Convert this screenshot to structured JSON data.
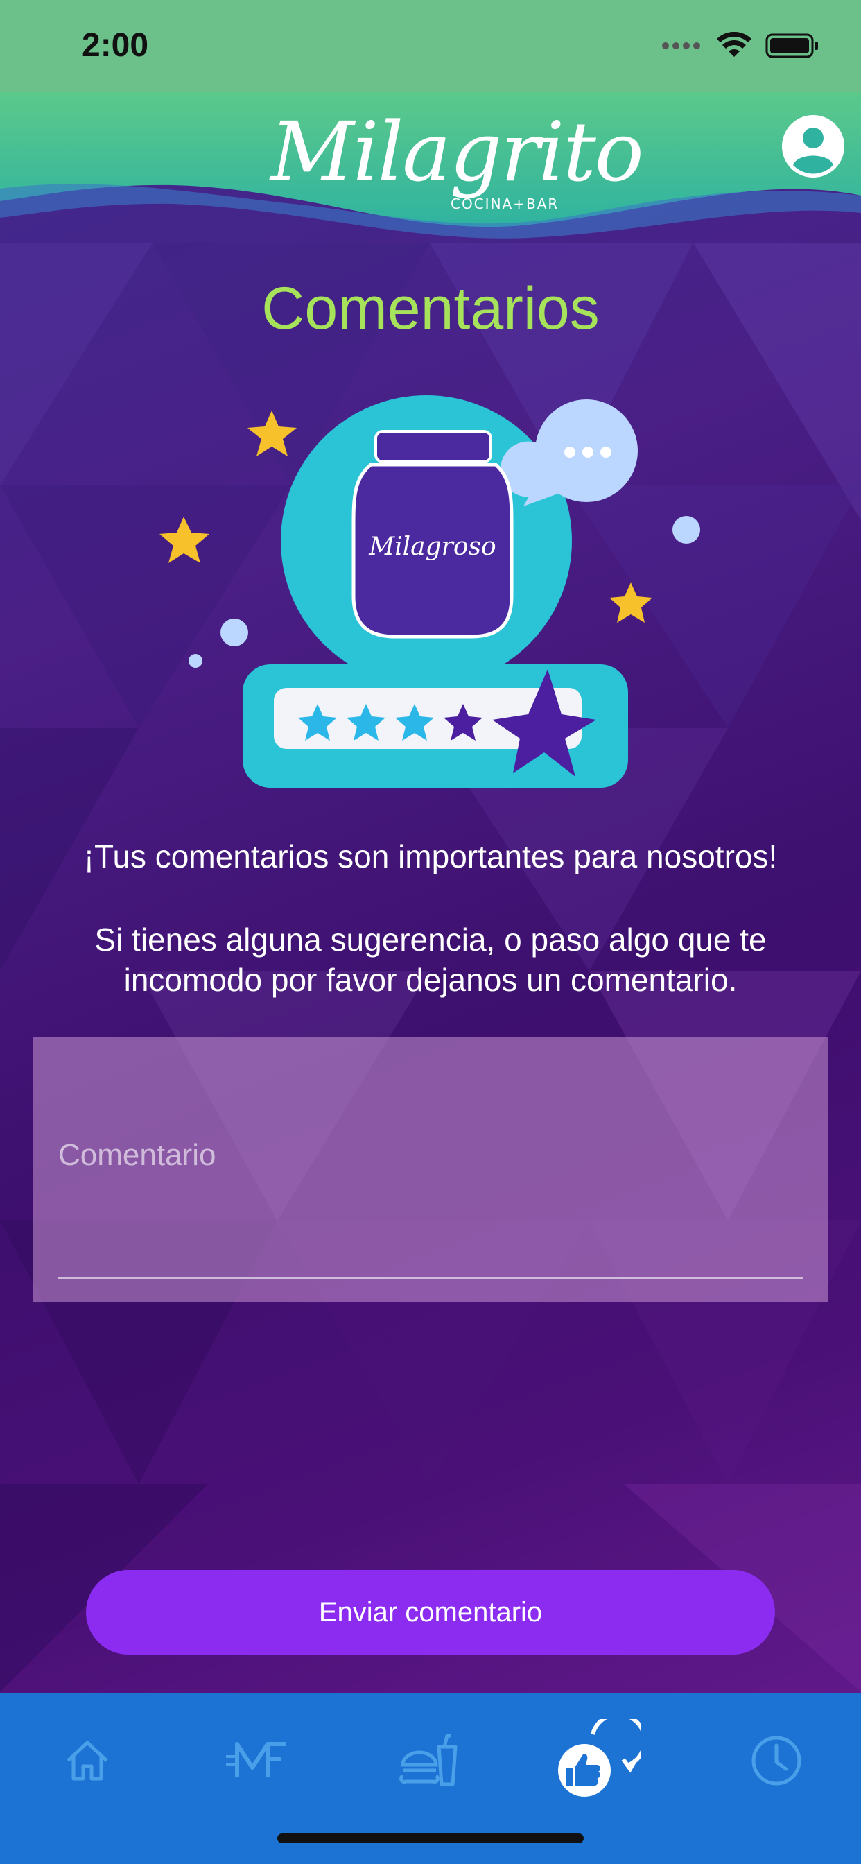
{
  "status_bar": {
    "time": "2:00"
  },
  "header": {
    "logo_text": "Milagrito",
    "logo_sub": "COCINA+BAR",
    "profile_icon": "user-profile-icon"
  },
  "page": {
    "title": "Comentarios",
    "illustration_jar_label": "Milagroso",
    "message_primary": "¡Tus comentarios son importantes para nosotros!",
    "message_secondary": "Si tienes alguna sugerencia, o paso algo que te incomodo por favor dejanos un comentario."
  },
  "form": {
    "comment_placeholder": "Comentario",
    "comment_value": "",
    "submit_label": "Enviar comentario"
  },
  "tab_bar": {
    "tabs": [
      {
        "icon": "home-icon",
        "active": false
      },
      {
        "icon": "milagrito-logo-icon",
        "active": false
      },
      {
        "icon": "food-icon",
        "active": false
      },
      {
        "icon": "feedback-thumbs-up-icon",
        "active": true
      },
      {
        "icon": "clock-icon",
        "active": false
      }
    ]
  },
  "colors": {
    "status_bar": "#6cc08a",
    "title": "#a6e35a",
    "button": "#8b2cf0",
    "tab_bar": "#1c73d4",
    "tab_icon_inactive": "#4aa0e8",
    "tab_icon_active": "#ffffff"
  }
}
